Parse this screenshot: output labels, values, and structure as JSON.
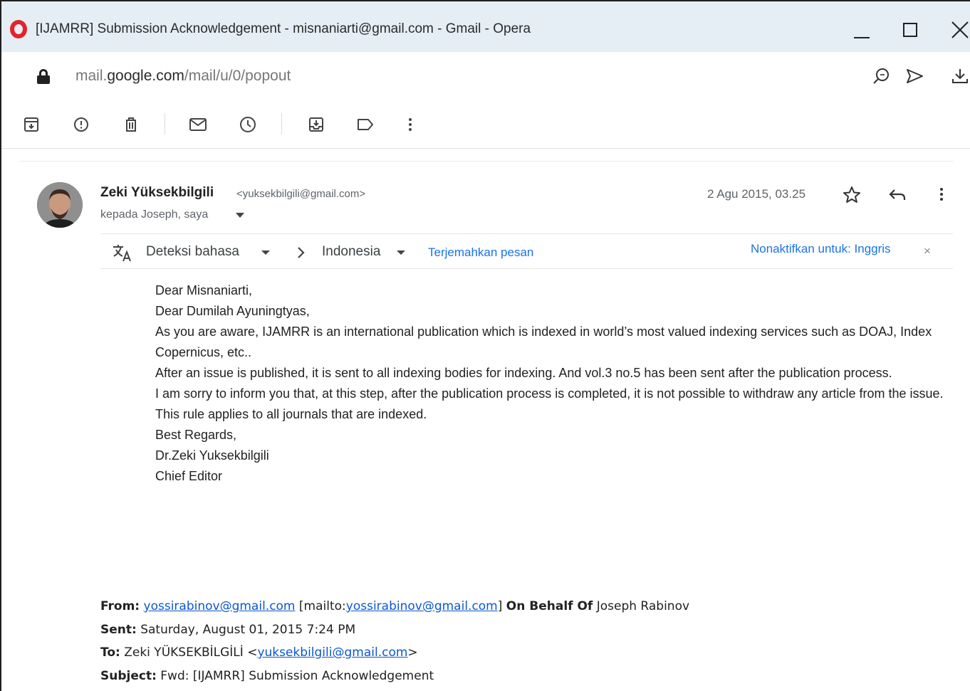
{
  "window": {
    "title": "[IJAMRR] Submission Acknowledgement - misnaniarti@gmail.com - Gmail - Opera"
  },
  "address": {
    "url_prefix": "mail.",
    "url_domain": "google.com",
    "url_path": "/mail/u/0/popout"
  },
  "message": {
    "sender_name": "Zeki Yüksekbilgili",
    "sender_email": "<yuksekbilgili@gmail.com>",
    "recipients": "kepada Joseph, saya",
    "date": "2 Agu 2015, 03.25"
  },
  "translate": {
    "detect_label": "Deteksi bahasa",
    "target_language": "Indonesia",
    "translate_link": "Terjemahkan pesan",
    "disable_link": "Nonaktifkan untuk: Inggris",
    "close": "×"
  },
  "body": {
    "lines": [
      "Dear Misnaniarti,",
      "Dear Dumilah Ayuningtyas,",
      "As you are aware, IJAMRR is an international publication which is indexed in world’s most valued indexing services such as DOAJ, Index Copernicus, etc..",
      "After an issue is published, it is sent to all indexing bodies for indexing. And vol.3 no.5 has been sent after the publication process.",
      "I am sorry to inform you that, at this step, after the publication process is completed, it is not possible to withdraw any article from the issue.",
      "This rule applies to all journals that are indexed.",
      "Best Regards,",
      "Dr.Zeki Yuksekbilgili",
      "Chief Editor"
    ]
  },
  "quote": {
    "from_label": "From:",
    "from_email": "yossirabinov@gmail.com",
    "mailto_open": "[mailto:",
    "mailto_email": "yossirabinov@gmail.com",
    "mailto_close": "]",
    "behalf_label": "On Behalf Of",
    "behalf_name": "Joseph Rabinov",
    "sent_label": "Sent:",
    "sent_value": "Saturday, August 01, 2015 7:24 PM",
    "to_label": "To:",
    "to_name": "Zeki YÜKSEKBİLGİLİ <",
    "to_email": "yuksekbilgili@gmail.com",
    "to_close": ">",
    "subject_label": "Subject:",
    "subject_value": "Fwd: [IJAMRR] Submission Acknowledgement"
  },
  "colors": {
    "titlebar_bg": "#e5edf5",
    "opera_red": "#e0252a",
    "link_blue": "#1a73e8"
  }
}
